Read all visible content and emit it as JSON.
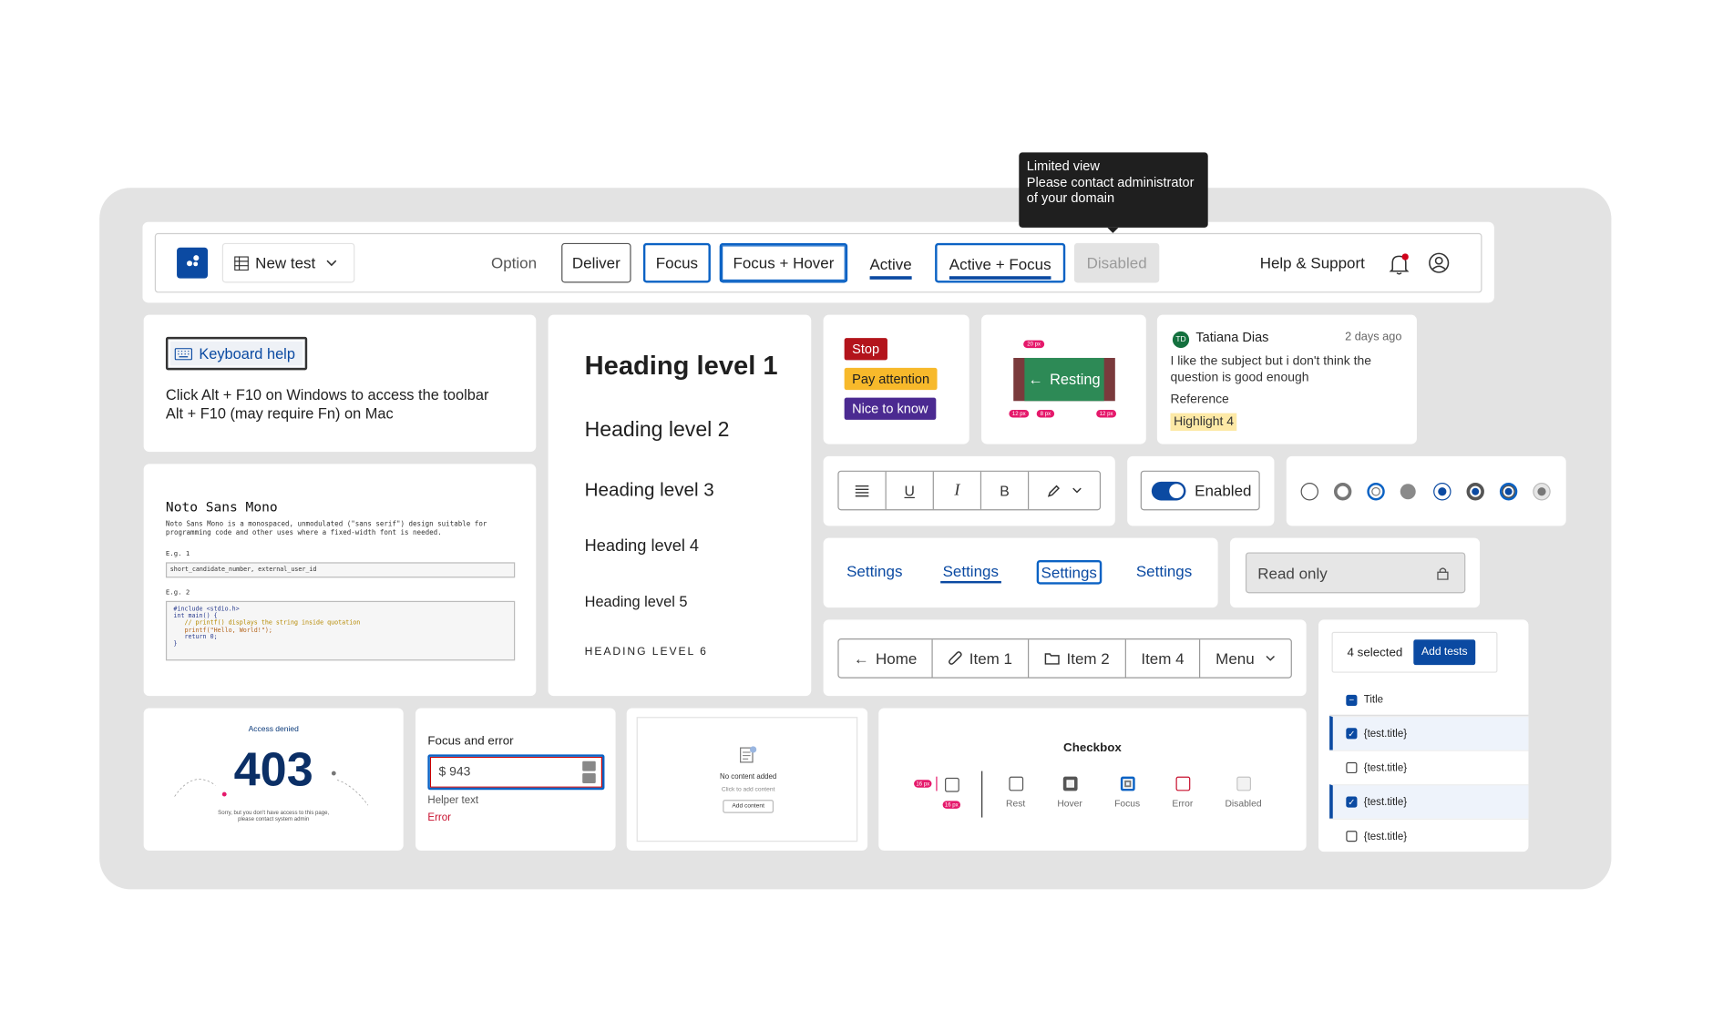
{
  "toolbar": {
    "new_test_label": "New test",
    "buttons": {
      "option": "Option",
      "deliver": "Deliver",
      "focus": "Focus",
      "focus_hover": "Focus + Hover",
      "active": "Active",
      "active_focus": "Active + Focus",
      "disabled": "Disabled"
    },
    "help_label": "Help & Support",
    "tooltip": {
      "title": "Limited view",
      "body": "Please contact administrator of your domain"
    }
  },
  "keyboard_help": {
    "button_label": "Keyboard help",
    "line1": "Click Alt + F10 on Windows to access the toolbar",
    "line2": "Alt + F10 (may require Fn) on Mac"
  },
  "mono": {
    "title": "Noto Sans Mono",
    "description": "Noto Sans Mono is a monospaced, unmodulated (\"sans serif\") design suitable for programming code and other uses where a fixed-width font is needed.",
    "eg1_label": "E.g. 1",
    "eg1_value": "short_candidate_number, external_user_id",
    "eg2_label": "E.g. 2",
    "code": [
      "#include <stdio.h>",
      "int main() {",
      "   // printf() displays the string inside quotation",
      "   printf(\"Hello, World!\");",
      "   return 0;",
      "}"
    ]
  },
  "headings": {
    "h1": "Heading level 1",
    "h2": "Heading level 2",
    "h3": "Heading level 3",
    "h4": "Heading level 4",
    "h5": "Heading level 5",
    "h6": "HEADING LEVEL 6"
  },
  "tags": [
    {
      "label": "Stop",
      "bg": "#b3141b",
      "fg": "#ffffff"
    },
    {
      "label": "Pay attention",
      "bg": "#f7b92b",
      "fg": "#1f1f1f"
    },
    {
      "label": "Nice to know",
      "bg": "#4b2a91",
      "fg": "#ffffff"
    }
  ],
  "spacing": {
    "button_label": "Resting",
    "top_label": "20 px",
    "left_label": "12 px",
    "mid_label": "8 px",
    "right_label": "12 px"
  },
  "comment": {
    "initials": "TD",
    "author": "Tatiana Dias",
    "time": "2 days ago",
    "text": "I like the subject but i don't think the question is good enough",
    "reference_label": "Reference",
    "highlight": "Highlight 4"
  },
  "format": {
    "underline": "U",
    "italic": "I",
    "bold": "B"
  },
  "toggle": {
    "label": "Enabled",
    "on": true
  },
  "tabs": [
    "Settings",
    "Settings",
    "Settings",
    "Settings"
  ],
  "readonly": {
    "value": "Read only"
  },
  "breadcrumbs": [
    "Home",
    "Item 1",
    "Item 2",
    "Item 4",
    "Menu"
  ],
  "list": {
    "selected_count": "4 selected",
    "add_button": "Add tests",
    "header": "Title",
    "rows": [
      {
        "title": "{test.title}",
        "checked": true
      },
      {
        "title": "{test.title}",
        "checked": false
      },
      {
        "title": "{test.title}",
        "checked": true
      },
      {
        "title": "{test.title}",
        "checked": false
      }
    ]
  },
  "error_page": {
    "title": "Access denied",
    "code": "403",
    "message_line1": "Sorry, but you don't have access to this page,",
    "message_line2": "please contact system admin"
  },
  "focus_error": {
    "label": "Focus and error",
    "value": "$ 943",
    "helper": "Helper text",
    "error": "Error"
  },
  "empty_state": {
    "title": "No content added",
    "subtitle": "Click to add content",
    "button": "Add content"
  },
  "checkbox_states": {
    "title": "Checkbox",
    "size_label_w": "16 px",
    "size_label_h": "16 px",
    "states": [
      "Rest",
      "Hover",
      "Focus",
      "Error",
      "Disabled"
    ]
  },
  "colors": {
    "primary": "#0b4aa2",
    "focus": "#0b62c4",
    "error": "#c8102e",
    "pink_annotation": "#e5196b"
  }
}
